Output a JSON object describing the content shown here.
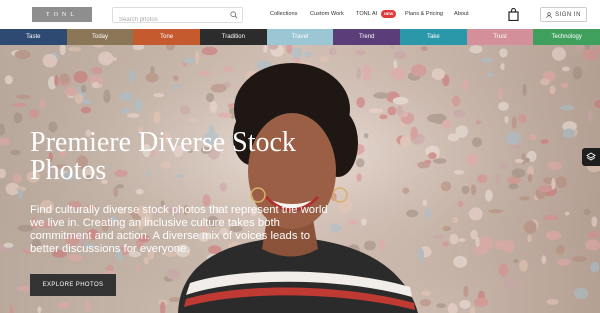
{
  "header": {
    "logo_text": "TONL",
    "search_placeholder": "Search photos",
    "nav": [
      {
        "label": "Collections"
      },
      {
        "label": "Custom Work"
      },
      {
        "label": "TONL AI"
      },
      {
        "label": "Plans & Pricing"
      },
      {
        "label": "About"
      }
    ],
    "ai_badge": "NEW",
    "signin_label": "SIGN IN"
  },
  "categories": [
    {
      "label": "Taste",
      "color": "#2f4a72"
    },
    {
      "label": "Today",
      "color": "#8b7758"
    },
    {
      "label": "Tone",
      "color": "#c65a2f"
    },
    {
      "label": "Tradition",
      "color": "#2c2c2c"
    },
    {
      "label": "Travel",
      "color": "#9bc6d3"
    },
    {
      "label": "Trend",
      "color": "#5b3d7a"
    },
    {
      "label": "Take",
      "color": "#2b98a9"
    },
    {
      "label": "Trust",
      "color": "#d3909a"
    },
    {
      "label": "Technology",
      "color": "#3fa05e"
    }
  ],
  "hero": {
    "title": "Premiere Diverse Stock Photos",
    "description": "Find culturally diverse stock photos that represent the world we live in. Creating an inclusive culture takes both commitment and action. A diverse mix of voices leads to better discussions for everyone.",
    "cta_label": "EXPLORE PHOTOS"
  }
}
